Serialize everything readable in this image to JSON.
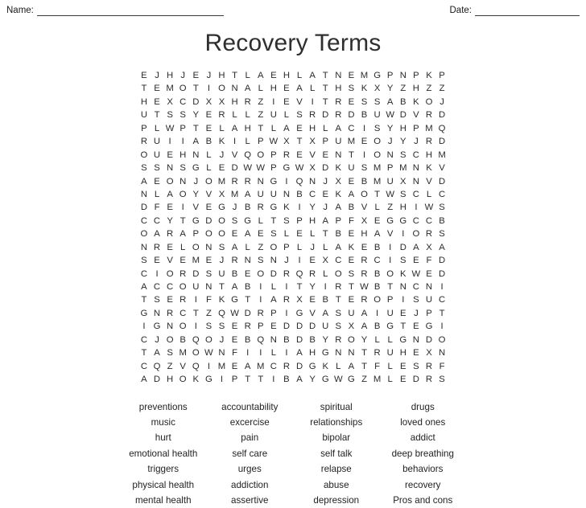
{
  "header": {
    "name_label": "Name:",
    "date_label": "Date:"
  },
  "title": "Recovery Terms",
  "grid": {
    "rows": 24,
    "cols": 24,
    "letters": [
      [
        "E",
        "J",
        "H",
        "J",
        "E",
        "J",
        "H",
        "T",
        "L",
        "A",
        "E",
        "H",
        "L",
        "A",
        "T",
        "N",
        "E",
        "M",
        "G",
        "P",
        "N",
        "P",
        "K",
        "P"
      ],
      [
        "T",
        "E",
        "M",
        "O",
        "T",
        "I",
        "O",
        "N",
        "A",
        "L",
        "H",
        "E",
        "A",
        "L",
        "T",
        "H",
        "S",
        "K",
        "X",
        "Y",
        "Z",
        "H",
        "Z",
        "Z"
      ],
      [
        "H",
        "E",
        "X",
        "C",
        "D",
        "X",
        "X",
        "H",
        "R",
        "Z",
        "I",
        "E",
        "V",
        "I",
        "T",
        "R",
        "E",
        "S",
        "S",
        "A",
        "B",
        "K",
        "O",
        "J"
      ],
      [
        "U",
        "T",
        "S",
        "S",
        "Y",
        "E",
        "R",
        "L",
        "L",
        "Z",
        "U",
        "L",
        "S",
        "R",
        "D",
        "R",
        "D",
        "B",
        "U",
        "W",
        "D",
        "V",
        "R",
        "D"
      ],
      [
        "P",
        "L",
        "W",
        "P",
        "T",
        "E",
        "L",
        "A",
        "H",
        "T",
        "L",
        "A",
        "E",
        "H",
        "L",
        "A",
        "C",
        "I",
        "S",
        "Y",
        "H",
        "P",
        "M",
        "Q"
      ],
      [
        "R",
        "U",
        "I",
        "I",
        "A",
        "B",
        "K",
        "I",
        "L",
        "P",
        "W",
        "X",
        "T",
        "X",
        "P",
        "U",
        "M",
        "E",
        "O",
        "J",
        "Y",
        "J",
        "R",
        "D"
      ],
      [
        "O",
        "U",
        "E",
        "H",
        "N",
        "L",
        "J",
        "V",
        "Q",
        "O",
        "P",
        "R",
        "E",
        "V",
        "E",
        "N",
        "T",
        "I",
        "O",
        "N",
        "S",
        "C",
        "H",
        "M"
      ],
      [
        "S",
        "S",
        "N",
        "S",
        "G",
        "L",
        "E",
        "D",
        "W",
        "W",
        "P",
        "G",
        "W",
        "X",
        "D",
        "K",
        "U",
        "S",
        "M",
        "P",
        "M",
        "N",
        "K",
        "V"
      ],
      [
        "A",
        "E",
        "O",
        "N",
        "J",
        "O",
        "M",
        "R",
        "R",
        "N",
        "G",
        "I",
        "Q",
        "N",
        "J",
        "X",
        "E",
        "B",
        "M",
        "U",
        "X",
        "N",
        "V",
        "D"
      ],
      [
        "N",
        "L",
        "A",
        "O",
        "Y",
        "V",
        "X",
        "M",
        "A",
        "U",
        "U",
        "N",
        "B",
        "C",
        "E",
        "K",
        "A",
        "O",
        "T",
        "W",
        "S",
        "C",
        "L",
        "C"
      ],
      [
        "D",
        "F",
        "E",
        "I",
        "V",
        "E",
        "G",
        "J",
        "B",
        "R",
        "G",
        "K",
        "I",
        "Y",
        "J",
        "A",
        "B",
        "V",
        "L",
        "Z",
        "H",
        "I",
        "W",
        "S"
      ],
      [
        "C",
        "C",
        "Y",
        "T",
        "G",
        "D",
        "O",
        "S",
        "G",
        "L",
        "T",
        "S",
        "P",
        "H",
        "A",
        "P",
        "F",
        "X",
        "E",
        "G",
        "G",
        "C",
        "C",
        "B"
      ],
      [
        "O",
        "A",
        "R",
        "A",
        "P",
        "O",
        "O",
        "E",
        "A",
        "E",
        "S",
        "L",
        "E",
        "L",
        "T",
        "B",
        "E",
        "H",
        "A",
        "V",
        "I",
        "O",
        "R",
        "S"
      ],
      [
        "N",
        "R",
        "E",
        "L",
        "O",
        "N",
        "S",
        "A",
        "L",
        "Z",
        "O",
        "P",
        "L",
        "J",
        "L",
        "A",
        "K",
        "E",
        "B",
        "I",
        "D",
        "A",
        "X",
        "A"
      ],
      [
        "S",
        "E",
        "V",
        "E",
        "M",
        "E",
        "J",
        "R",
        "N",
        "S",
        "N",
        "J",
        "I",
        "E",
        "X",
        "C",
        "E",
        "R",
        "C",
        "I",
        "S",
        "E",
        "F",
        "D"
      ],
      [
        "C",
        "I",
        "O",
        "R",
        "D",
        "S",
        "U",
        "B",
        "E",
        "O",
        "D",
        "R",
        "Q",
        "R",
        "L",
        "O",
        "S",
        "R",
        "B",
        "O",
        "K",
        "W",
        "E",
        "D"
      ],
      [
        "A",
        "C",
        "C",
        "O",
        "U",
        "N",
        "T",
        "A",
        "B",
        "I",
        "L",
        "I",
        "T",
        "Y",
        "I",
        "R",
        "T",
        "W",
        "B",
        "T",
        "N",
        "C",
        "N",
        "I"
      ],
      [
        "T",
        "S",
        "E",
        "R",
        "I",
        "F",
        "K",
        "G",
        "T",
        "I",
        "A",
        "R",
        "X",
        "E",
        "B",
        "T",
        "E",
        "R",
        "O",
        "P",
        "I",
        "S",
        "U",
        "C"
      ],
      [
        "G",
        "N",
        "R",
        "C",
        "T",
        "Z",
        "Q",
        "W",
        "D",
        "R",
        "P",
        "I",
        "G",
        "V",
        "A",
        "S",
        "U",
        "A",
        "I",
        "U",
        "E",
        "J",
        "P",
        "T"
      ],
      [
        "I",
        "G",
        "N",
        "O",
        "I",
        "S",
        "S",
        "E",
        "R",
        "P",
        "E",
        "D",
        "D",
        "D",
        "U",
        "S",
        "X",
        "A",
        "B",
        "G",
        "T",
        "E",
        "G",
        "I"
      ],
      [
        "C",
        "J",
        "O",
        "B",
        "Q",
        "O",
        "J",
        "E",
        "B",
        "Q",
        "N",
        "B",
        "D",
        "B",
        "Y",
        "R",
        "O",
        "Y",
        "L",
        "L",
        "G",
        "N",
        "D",
        "O"
      ],
      [
        "T",
        "A",
        "S",
        "M",
        "O",
        "W",
        "N",
        "F",
        "I",
        "I",
        "L",
        "I",
        "A",
        "H",
        "G",
        "N",
        "N",
        "T",
        "R",
        "U",
        "H",
        "E",
        "X",
        "N"
      ],
      [
        "C",
        "Q",
        "Z",
        "V",
        "Q",
        "I",
        "M",
        "E",
        "A",
        "M",
        "C",
        "R",
        "D",
        "G",
        "K",
        "L",
        "A",
        "T",
        "F",
        "L",
        "E",
        "S",
        "R",
        "F"
      ],
      [
        "A",
        "D",
        "H",
        "O",
        "K",
        "G",
        "I",
        "P",
        "T",
        "T",
        "I",
        "B",
        "A",
        "Y",
        "G",
        "W",
        "G",
        "Z",
        "M",
        "L",
        "E",
        "D",
        "R",
        "S"
      ]
    ]
  },
  "wordlist": {
    "columns": 4,
    "words": [
      "preventions",
      "accountability",
      "spiritual",
      "drugs",
      "music",
      "excercise",
      "relationships",
      "loved ones",
      "hurt",
      "pain",
      "bipolar",
      "addict",
      "emotional health",
      "self care",
      "self talk",
      "deep breathing",
      "triggers",
      "urges",
      "relapse",
      "behaviors",
      "physical health",
      "addiction",
      "abuse",
      "recovery",
      "mental health",
      "assertive",
      "depression",
      "Pros and cons"
    ]
  },
  "colors": {
    "text": "#2b2b2b",
    "title": "#2f2f2f",
    "rule": "#3a3a3a",
    "background": "#ffffff"
  }
}
